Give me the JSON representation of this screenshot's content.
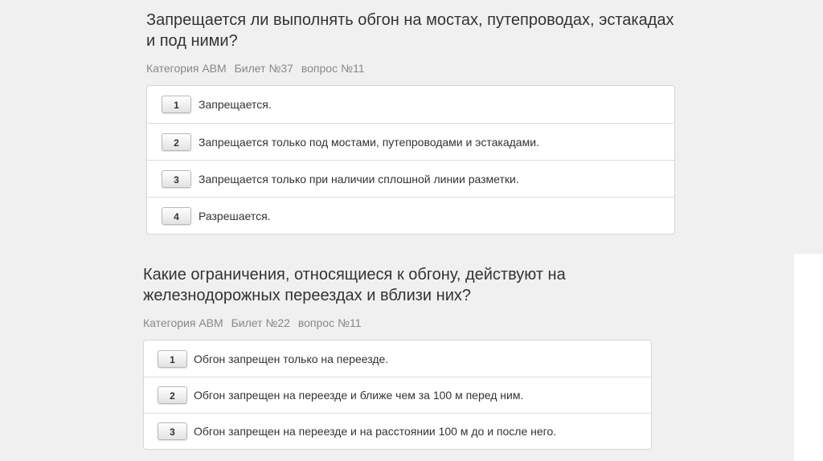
{
  "questions": [
    {
      "title": "Запрещается ли выполнять обгон на мостах, путепроводах, эстакадах и под ними?",
      "category": "Категория АВМ",
      "ticket": "Билет №37",
      "question_no": "вопрос №11",
      "answers": [
        {
          "num": "1",
          "text": "Запрещается."
        },
        {
          "num": "2",
          "text": "Запрещается только под мостами, путепроводами и эстакадами."
        },
        {
          "num": "3",
          "text": "Запрещается только при наличии сплошной линии разметки."
        },
        {
          "num": "4",
          "text": "Разрешается."
        }
      ]
    },
    {
      "title": "Какие ограничения, относящиеся к обгону, действуют на железнодорожных переездах и вблизи них?",
      "category": "Категория АВМ",
      "ticket": "Билет №22",
      "question_no": "вопрос №11",
      "answers": [
        {
          "num": "1",
          "text": "Обгон запрещен только на переезде."
        },
        {
          "num": "2",
          "text": "Обгон запрещен на переезде и ближе чем за 100 м перед ним."
        },
        {
          "num": "3",
          "text": "Обгон запрещен на переезде и на расстоянии 100 м до и после него."
        }
      ]
    }
  ]
}
